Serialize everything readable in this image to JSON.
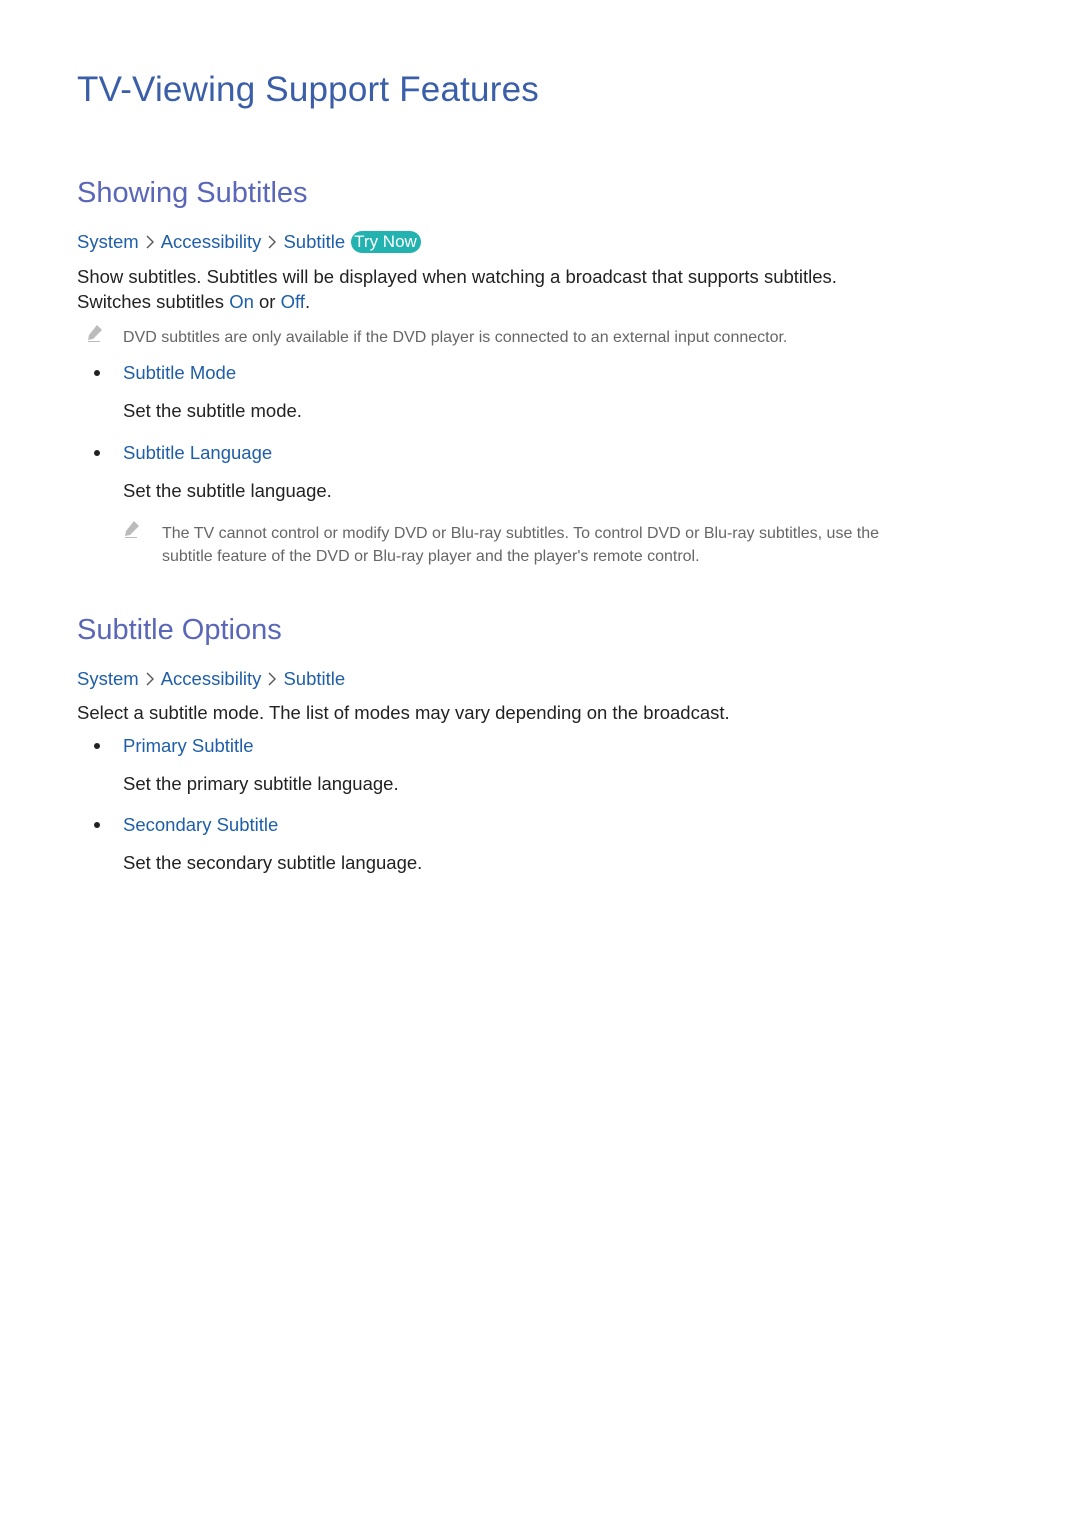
{
  "page_title": "TV-Viewing Support Features",
  "sections": [
    {
      "heading": "Showing Subtitles",
      "breadcrumb": [
        "System",
        "Accessibility",
        "Subtitle"
      ],
      "try_now_label": "Try Now",
      "description_line1": "Show subtitles. Subtitles will be displayed when watching a broadcast that supports subtitles.",
      "description_line2_prefix": "Switches subtitles ",
      "description_on": "On",
      "description_or": " or ",
      "description_off": "Off",
      "description_suffix": ".",
      "note": "DVD subtitles are only available if the DVD player is connected to an external input connector.",
      "items": [
        {
          "title": "Subtitle Mode",
          "description": "Set the subtitle mode."
        },
        {
          "title": "Subtitle Language",
          "description": "Set the subtitle language."
        }
      ],
      "sub_note_line1": "The TV cannot control or modify DVD or Blu-ray subtitles. To control DVD or Blu-ray subtitles, use the",
      "sub_note_line2": "subtitle feature of the DVD or Blu-ray player and the player's remote control."
    },
    {
      "heading": "Subtitle Options",
      "breadcrumb": [
        "System",
        "Accessibility",
        "Subtitle"
      ],
      "description": "Select a subtitle mode. The list of modes may vary depending on the broadcast.",
      "items": [
        {
          "title": "Primary Subtitle",
          "description": "Set the primary subtitle language."
        },
        {
          "title": "Secondary Subtitle",
          "description": "Set the secondary subtitle language."
        }
      ]
    }
  ],
  "icons": {
    "breadcrumb_separator": "chevron-right-icon",
    "note": "pencil-icon",
    "list_bullet": "bullet-icon"
  },
  "colors": {
    "title": "#3a5ea8",
    "heading": "#5a66b8",
    "link": "#1f5ea8",
    "try_now_bg": "#22b2b0",
    "body_text": "#222222",
    "note_text": "#666666"
  }
}
